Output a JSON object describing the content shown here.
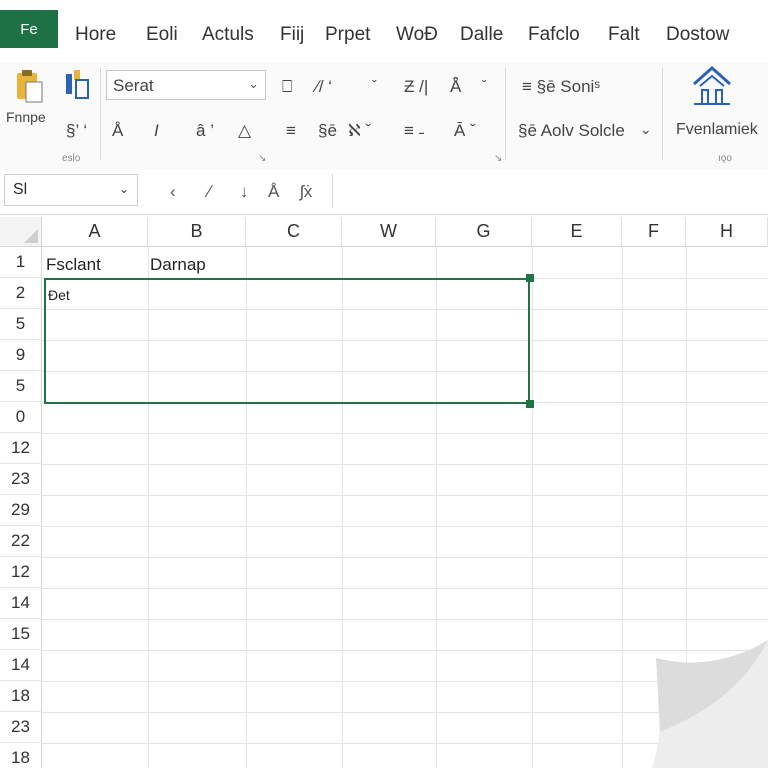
{
  "menu": {
    "file_tab": "Fe",
    "items": [
      "Hore",
      "Eoli",
      "Actuls",
      "Fiij",
      "Prpet",
      "WoƉ",
      "Dalle",
      "Fafclo",
      "Falt",
      "Dostow"
    ]
  },
  "ribbon": {
    "font_name": "Serat",
    "paste_label": "Fnnpe",
    "align_label": "≡ §ē Soniˢ",
    "format_label": "§ē Aolv Solcle",
    "house_label": "Fvenlamiek",
    "group_labels": [
      "eslo",
      "ıo̧o"
    ],
    "row1_symbols": [
      "⎕",
      "∕/ ‘",
      "ˇ",
      "Ƶ /|",
      "Å̑",
      "ˇ"
    ],
    "row2_symbols": [
      "§’ ‘",
      "Å",
      "I",
      "â ’",
      "△",
      "≡",
      "§ē",
      "ℵ ˇ",
      "≡ ˗",
      "Ā ˇ"
    ],
    "dialog_launchers": [
      "↘",
      "↘",
      "↘"
    ]
  },
  "formula_bar": {
    "name_box": "Sl",
    "buttons": [
      "‹",
      "∕",
      "↓",
      "Å",
      "ʃẋ"
    ],
    "value": ""
  },
  "grid": {
    "columns": [
      "A",
      "B",
      "C",
      "W",
      "G",
      "E",
      "F",
      "H"
    ],
    "rows": [
      "1",
      "2",
      "5",
      "9",
      "5",
      "0",
      "12",
      "23",
      "29",
      "22",
      "12",
      "14",
      "15",
      "14",
      "18",
      "23",
      "18"
    ],
    "cells": {
      "A1": "Fsclant",
      "B1": "Darnap",
      "A2": "Đet"
    }
  }
}
